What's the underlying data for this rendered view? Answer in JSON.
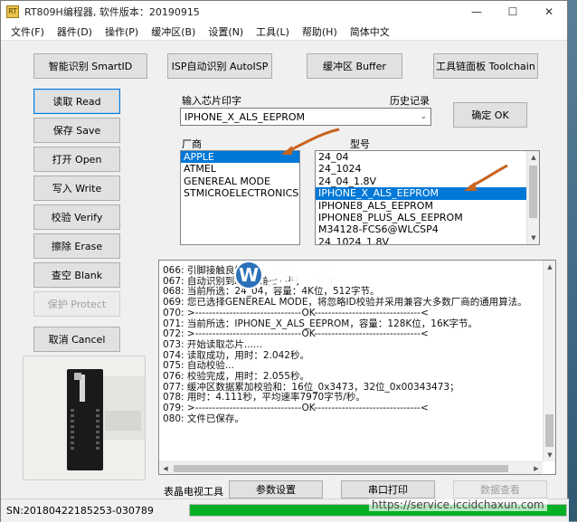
{
  "window": {
    "title": "RT809H编程器, 软件版本：20190915",
    "icon_text": "RT",
    "controls": {
      "minimize": "—",
      "maximize": "☐",
      "close": "✕"
    }
  },
  "menu": [
    "文件(F)",
    "器件(D)",
    "操作(P)",
    "缓冲区(B)",
    "设置(N)",
    "工具(L)",
    "帮助(H)",
    "简体中文"
  ],
  "top_buttons": {
    "smart_id": "智能识别 SmartID",
    "isp_auto": "ISP自动识别 AutoISP",
    "buffer": "缓冲区 Buffer",
    "toolchain": "工具链面板 Toolchain"
  },
  "side_buttons": {
    "read": "读取 Read",
    "save": "保存 Save",
    "open": "打开 Open",
    "write": "写入 Write",
    "verify": "校验 Verify",
    "erase": "擦除 Erase",
    "blank": "查空 Blank",
    "protect": "保护 Protect",
    "cancel": "取消 Cancel"
  },
  "chip_input": {
    "label": "输入芯片印字",
    "history_label": "历史记录",
    "value": "IPHONE_X_ALS_EEPROM",
    "ok_button": "确定 OK"
  },
  "vendor": {
    "label": "厂商",
    "items": [
      "APPLE",
      "ATMEL",
      "GENEREAL MODE",
      "STMICROELECTRONICS"
    ],
    "selected_index": 0
  },
  "model": {
    "label": "型号",
    "items": [
      "24_04",
      "24_1024",
      "24_04_1.8V",
      "IPHONE_X_ALS_EEPROM",
      "IPHONE8_ALS_EEPROM",
      "IPHONE8_PLUS_ALS_EEPROM",
      "M34128-FCS6@WLCSP4",
      "24_1024_1.8V"
    ],
    "selected_index": 3
  },
  "log_lines": [
    "066: 引脚接触良好",
    "067: 自动识别到芯片...前的型号",
    "068: 当前所选：24_04，容量：4K位，512字节。",
    "069: 您已选择GENEREAL MODE，将忽略ID校验并采用兼容大多数厂商的通用算法。",
    "070: >-------------------------------OK-------------------------------<",
    "071: 当前所选：IPHONE_X_ALS_EEPROM，容量：128K位，16K字节。",
    "072: >-------------------------------OK-------------------------------<",
    "073: 开始读取芯片......",
    "074: 读取成功，用时：2.042秒。",
    "075: 自动校验...",
    "076: 校验完成，用时：2.055秒。",
    "077: 缓冲区数据累加校验和：16位_0x3473，32位_0x00343473；",
    "078: 用时：4.111秒，平均速率7970字节/秒。",
    "079: >-------------------------------OK-------------------------------<",
    "080: 文件已保存。"
  ],
  "bottom_bar": {
    "label": "表晶电视工具",
    "params": "参数设置",
    "serial": "串口打印",
    "data_view": "数据查看"
  },
  "status": {
    "serial_number": "SN:20180422185253-030789",
    "progress": 1.0
  },
  "watermark": {
    "logo_letter": "W",
    "logo_text": "维修客",
    "url": "https://service.iccidchaxun.com"
  },
  "colors": {
    "selection": "#0078d7",
    "progress_fill": "#06b025",
    "arrow": "#c8641e",
    "watermark_blue": "#2b71b8"
  }
}
